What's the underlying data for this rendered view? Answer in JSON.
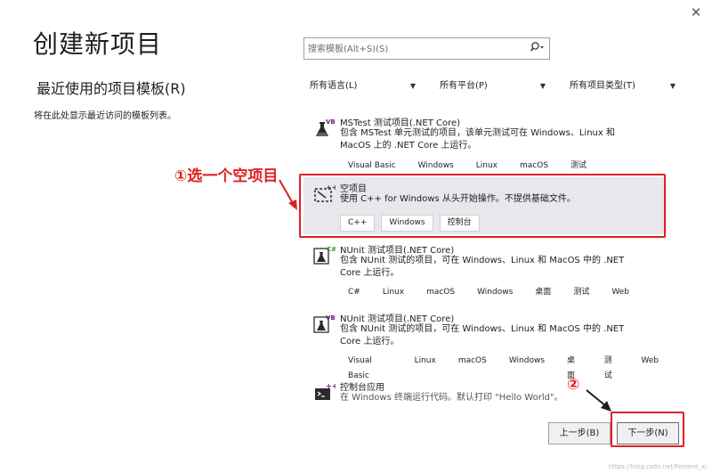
{
  "window": {
    "close_glyph": "✕",
    "title": "创建新项目"
  },
  "recent": {
    "heading": "最近使用的项目模板(R)",
    "description": "将在此处显示最近访问的模板列表。"
  },
  "search": {
    "placeholder": "搜索模板(Alt+S)(S)"
  },
  "filters": {
    "language": "所有语言(L)",
    "platform": "所有平台(P)",
    "project_type": "所有项目类型(T)"
  },
  "templates": [
    {
      "name": "MSTest 测试项目(.NET Core)",
      "description": "包含 MSTest 单元测试的项目，该单元测试可在 Windows、Linux 和 MacOS 上的 .NET Core 上运行。",
      "icon": "flask-vb-icon",
      "badge": "VB",
      "tags": [
        "Visual Basic",
        "Windows",
        "Linux",
        "macOS",
        "测试"
      ]
    },
    {
      "name": "空项目",
      "description": "使用 C++ for Windows 从头开始操作。不提供基础文件。",
      "icon": "empty-project-cpp-icon",
      "badge": "++",
      "selected": true,
      "tags": [
        "C++",
        "Windows",
        "控制台"
      ]
    },
    {
      "name": "NUnit 测试项目(.NET Core)",
      "description": "包含 NUnit 测试的项目，可在 Windows、Linux 和 MacOS 中的 .NET Core 上运行。",
      "icon": "flask-cs-icon",
      "badge": "C#",
      "tags": [
        "C#",
        "Linux",
        "macOS",
        "Windows",
        "桌面",
        "测试",
        "Web"
      ]
    },
    {
      "name": "NUnit 测试项目(.NET Core)",
      "description": "包含 NUnit 测试的项目，可在 Windows、Linux 和 MacOS 中的 .NET Core 上运行。",
      "icon": "flask-vb-icon",
      "badge": "VB",
      "tags": [
        "Visual Basic",
        "Linux",
        "macOS",
        "Windows",
        "桌面",
        "测试",
        "Web"
      ]
    },
    {
      "name": "控制台应用",
      "description": "在 Windows 终端运行代码。默认打印 \"Hello World\"。",
      "icon": "console-cpp-icon",
      "badge": "++",
      "tags": []
    }
  ],
  "annotations": {
    "step1": "①选一个空项目",
    "step2": "②"
  },
  "buttons": {
    "back": "上一步(B)",
    "next": "下一步(N)"
  },
  "watermark": "https://blog.csdn.net/Feinerd_xi",
  "colors": {
    "annotation_red": "#e02020",
    "selected_bg": "#e8e8ec",
    "vs_purple": "#68217a"
  }
}
